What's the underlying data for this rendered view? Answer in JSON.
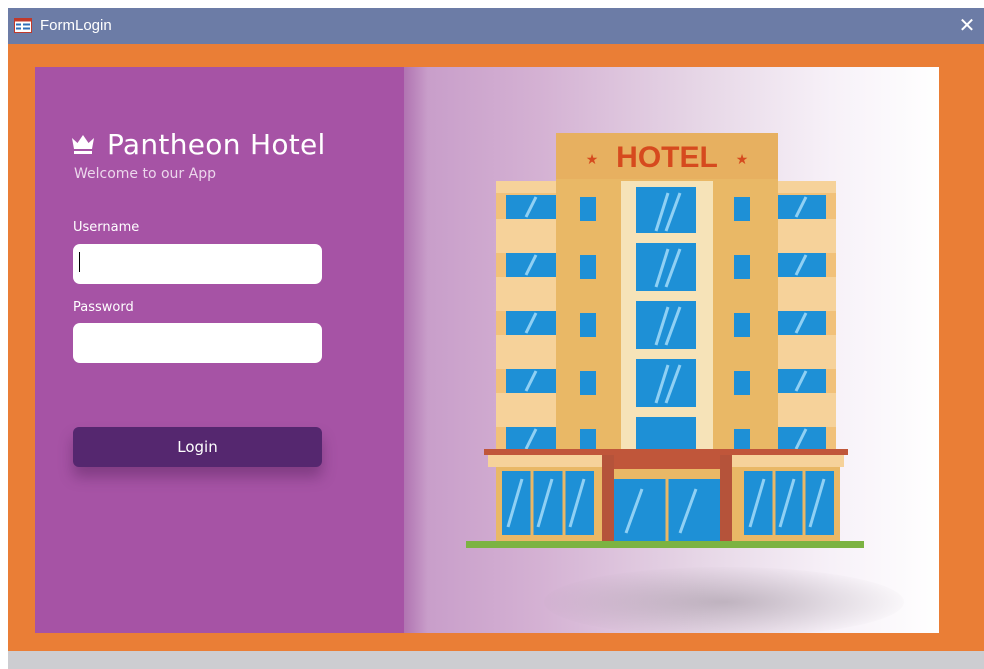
{
  "window": {
    "title": "FormLogin"
  },
  "brand": {
    "name": "Pantheon Hotel",
    "subtitle": "Welcome to our App"
  },
  "login_form": {
    "username_label": "Username",
    "username_value": "",
    "password_label": "Password",
    "password_value": "",
    "login_label": "Login"
  },
  "illustration": {
    "sign_text": "HOTEL",
    "icon": "hotel-building-illustration"
  },
  "colors": {
    "titlebar": "#6c7ca6",
    "form_background": "#ea7e36",
    "left_panel": "#a653a5",
    "login_button": "#55276f"
  }
}
